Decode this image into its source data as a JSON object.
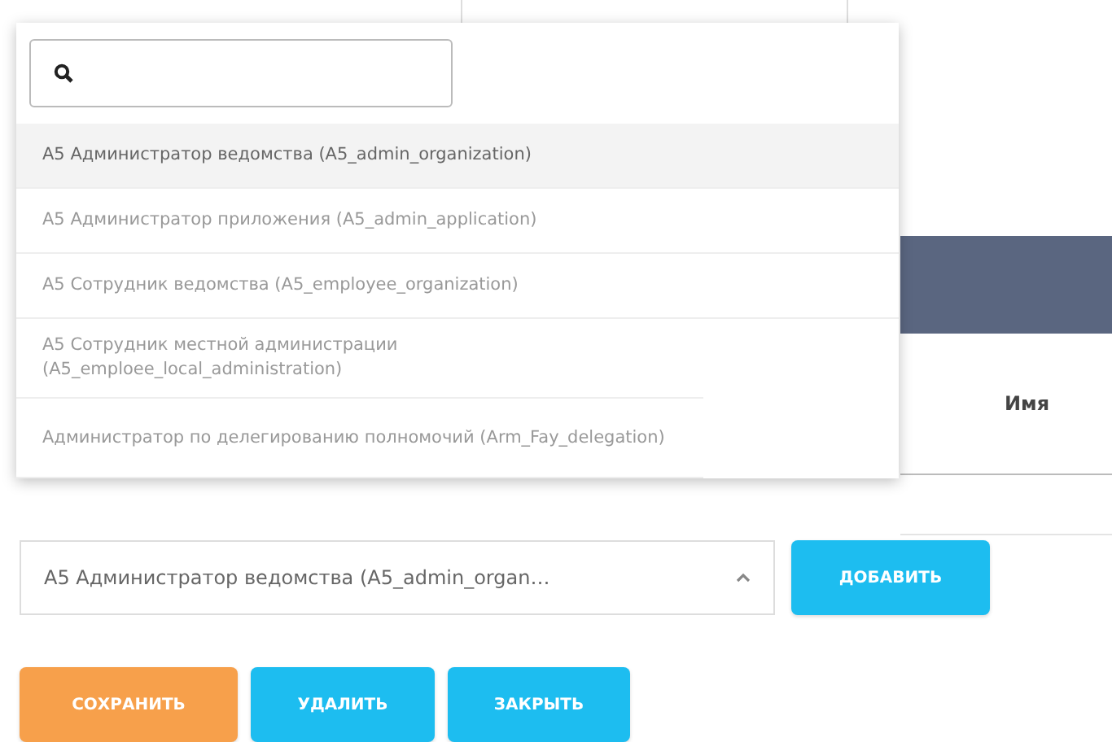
{
  "table": {
    "columns": [
      {
        "label": "Имя"
      }
    ]
  },
  "role_select": {
    "value": "А5 Администратор ведомства (A5_admin_organ…",
    "expanded": true,
    "options": [
      {
        "label": "А5 Администратор ведомства (A5_admin_organization)",
        "selected": true
      },
      {
        "label": "А5 Администратор приложения (A5_admin_application)",
        "selected": false
      },
      {
        "label": "А5 Сотрудник ведомства (A5_employee_organization)",
        "selected": false
      },
      {
        "label": "А5 Сотрудник местной администрации (A5_emploee_local_administration)",
        "selected": false
      },
      {
        "label": "Администратор по делегированию полномочий (Arm_Fay_delegation)",
        "selected": false
      }
    ]
  },
  "add_button": {
    "label": "ДОБАВИТЬ",
    "kind": "primary"
  },
  "buttons": [
    {
      "label": "СОХРАНИТЬ",
      "kind": "warning"
    },
    {
      "label": "УДАЛИТЬ",
      "kind": "primary"
    },
    {
      "label": "ЗАКРЫТЬ",
      "kind": "primary"
    }
  ]
}
